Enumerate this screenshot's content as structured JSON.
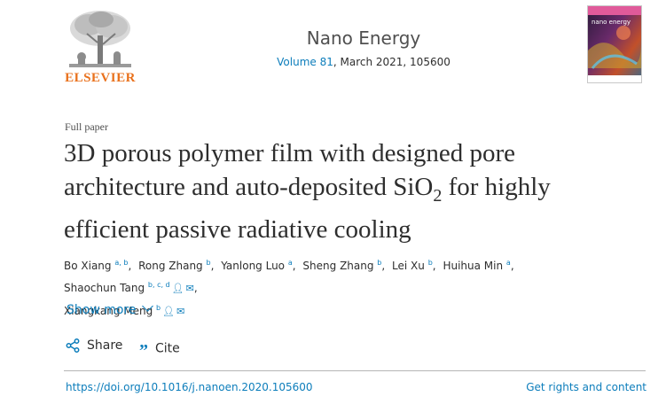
{
  "publisher": {
    "name": "ELSEVIER"
  },
  "journal": {
    "title": "Nano Energy",
    "volume_link": "Volume 81",
    "issue_rest": ", March 2021, 105600",
    "cover_title": "nano energy"
  },
  "article": {
    "type": "Full paper",
    "title_part1": "3D porous polymer film with designed pore architecture and auto-deposited SiO",
    "title_sub": "2",
    "title_part2": " for highly efficient passive radiative cooling"
  },
  "authors": [
    {
      "name": "Bo Xiang",
      "aff": "a, b",
      "contact": false
    },
    {
      "name": "Rong Zhang",
      "aff": "b",
      "contact": false
    },
    {
      "name": "Yanlong Luo",
      "aff": "a",
      "contact": false
    },
    {
      "name": "Sheng Zhang",
      "aff": "b",
      "contact": false
    },
    {
      "name": "Lei Xu",
      "aff": "b",
      "contact": false
    },
    {
      "name": "Huihua Min",
      "aff": "a",
      "contact": false
    },
    {
      "name": "Shaochun Tang",
      "aff": "b, c, d",
      "contact": true
    },
    {
      "name": "Xiangkang Meng",
      "aff": "b",
      "contact": true
    }
  ],
  "actions": {
    "show_more": "Show more",
    "share": "Share",
    "cite": "Cite"
  },
  "footer": {
    "doi": "https://doi.org/10.1016/j.nanoen.2020.105600",
    "rights": "Get rights and content"
  },
  "colors": {
    "link": "#0c7dbb",
    "elsevier_orange": "#e9711c",
    "text": "#2e2e2e"
  }
}
